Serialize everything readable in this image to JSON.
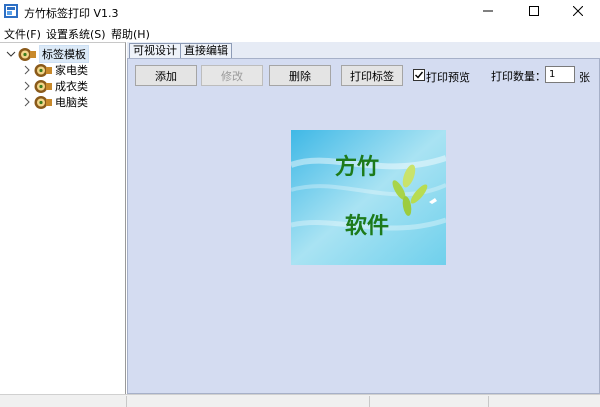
{
  "window": {
    "title": "方竹标签打印 V1.3"
  },
  "menu": {
    "items": [
      "文件(F)",
      "设置系统(S)",
      "帮助(H)"
    ]
  },
  "tree": {
    "root": "标签模板",
    "children": [
      "家电类",
      "成衣类",
      "电脑类"
    ]
  },
  "tabs": [
    "可视设计",
    "直接编辑"
  ],
  "toolbar": {
    "add": "添加",
    "modify": "修改",
    "delete": "删除",
    "print_label": "打印标签",
    "print_preview": "打印预览",
    "print_preview_checked": true,
    "qty_label": "打印数量：",
    "qty_value": "1",
    "qty_unit": "张"
  },
  "preview": {
    "line1": "方竹",
    "line2": "软件"
  },
  "colors": {
    "content_bg": "#d4dcf1",
    "preview_text": "#1d7a1a"
  }
}
